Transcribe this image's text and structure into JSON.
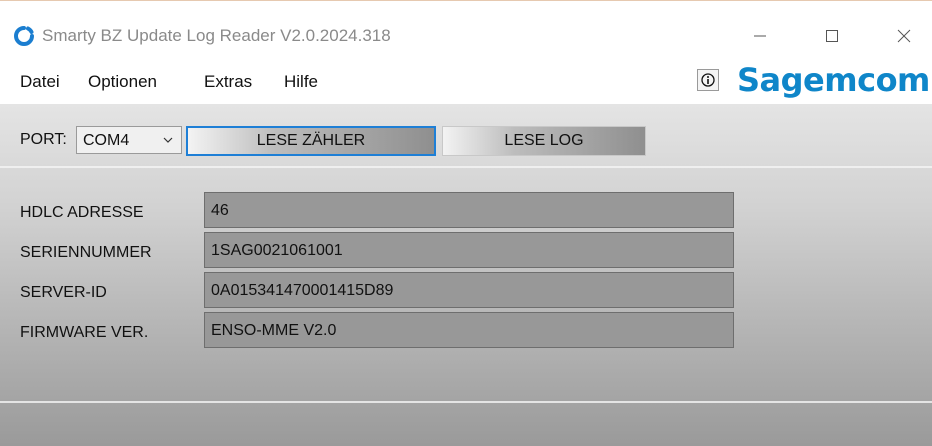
{
  "window": {
    "title": "Smarty BZ Update Log Reader V2.0.2024.318"
  },
  "menu": {
    "items": [
      {
        "label": "Datei"
      },
      {
        "label": "Optionen"
      },
      {
        "label": "Extras"
      },
      {
        "label": "Hilfe"
      }
    ],
    "logo": "Sagemcom"
  },
  "toolbar": {
    "port_label": "PORT:",
    "port_value": "COM4",
    "read_meter_label": "LESE ZÄHLER",
    "read_log_label": "LESE LOG"
  },
  "fields": [
    {
      "label": "HDLC ADRESSE",
      "value": "46"
    },
    {
      "label": "SERIENNUMMER",
      "value": "1SAG0021061001"
    },
    {
      "label": "SERVER-ID",
      "value": "0A015341470001415D89"
    },
    {
      "label": "FIRMWARE VER.",
      "value": "ENSO-MME V2.0"
    }
  ],
  "colors": {
    "logo": "#0f86c9",
    "focus_border": "#1e7fd6"
  }
}
